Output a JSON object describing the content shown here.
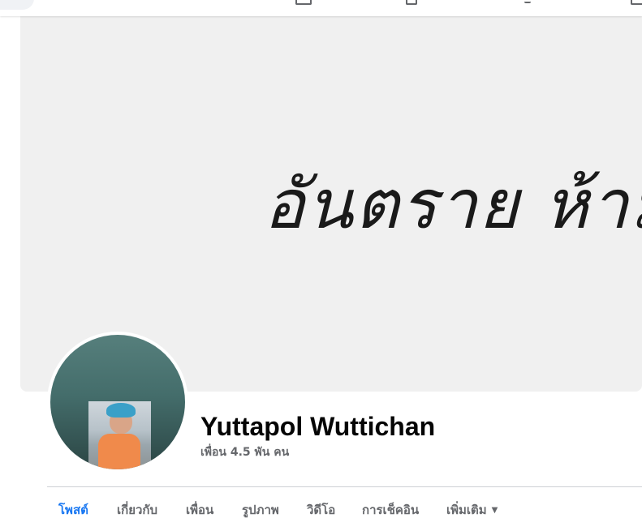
{
  "cover": {
    "text": "อันตราย ห้ามเ"
  },
  "profile": {
    "name": "Yuttapol Wuttichan",
    "friends": "เพื่อน 4.5 พัน คน"
  },
  "tabs": [
    {
      "label": "โพสต์",
      "active": true
    },
    {
      "label": "เกี่ยวกับ",
      "active": false
    },
    {
      "label": "เพื่อน",
      "active": false
    },
    {
      "label": "รูปภาพ",
      "active": false
    },
    {
      "label": "วิดีโอ",
      "active": false
    },
    {
      "label": "การเช็คอิน",
      "active": false
    },
    {
      "label": "เพิ่มเติม",
      "active": false,
      "icon": "caret-down-icon"
    }
  ],
  "colors": {
    "accent": "#1877f2",
    "text_secondary": "#65676b",
    "cover_bg": "#f0f0f0"
  }
}
